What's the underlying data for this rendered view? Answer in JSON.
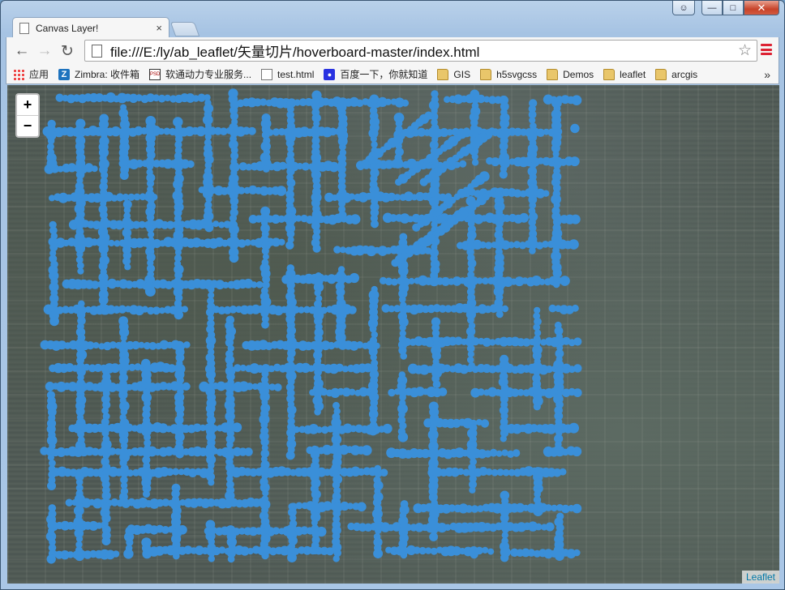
{
  "window": {
    "caption_buttons": [
      "user",
      "minimize",
      "maximize",
      "close"
    ]
  },
  "tab": {
    "title": "Canvas Layer!",
    "close_label": "×"
  },
  "toolbar": {
    "back_label": "←",
    "forward_label": "→",
    "reload_label": "C",
    "url": "file:///E:/ly/ab_leaflet/矢量切片/hoverboard-master/index.html",
    "star_label": "☆"
  },
  "bookmarks": {
    "items": [
      {
        "label": "应用",
        "icon": "apps-icon"
      },
      {
        "label": "Zimbra: 收件箱",
        "icon": "zimbra-icon"
      },
      {
        "label": "软通动力专业服务...",
        "icon": "psd-icon"
      },
      {
        "label": "test.html",
        "icon": "document-icon"
      },
      {
        "label": "百度一下，你就知道",
        "icon": "baidu-icon"
      },
      {
        "label": "GIS",
        "icon": "folder-icon"
      },
      {
        "label": "h5svgcss",
        "icon": "folder-icon"
      },
      {
        "label": "Demos",
        "icon": "folder-icon"
      },
      {
        "label": "leaflet",
        "icon": "folder-icon"
      },
      {
        "label": "arcgis",
        "icon": "folder-icon"
      }
    ],
    "more_label": "»"
  },
  "map": {
    "zoom_in_label": "+",
    "zoom_out_label": "−",
    "attribution": "Leaflet",
    "overlay_color": "#3a8fd9"
  }
}
